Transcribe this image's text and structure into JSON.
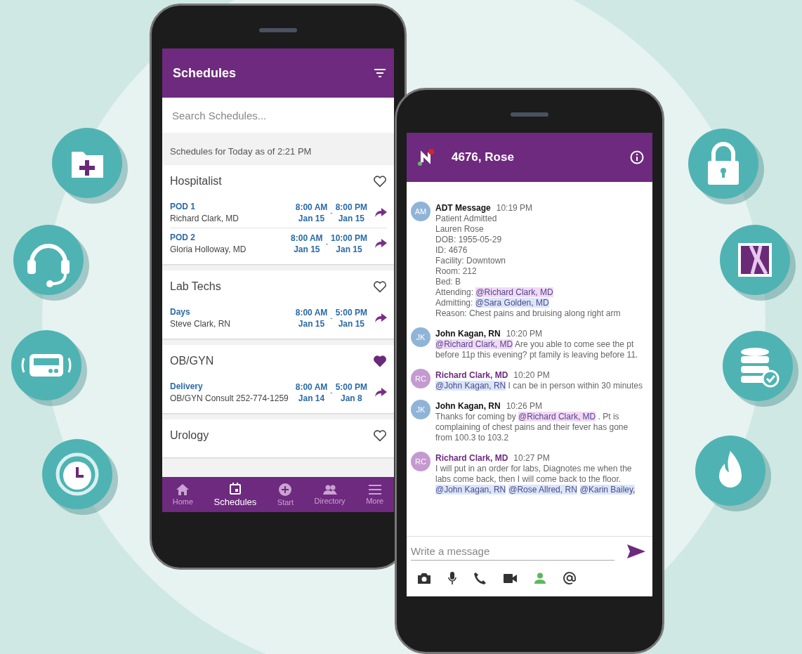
{
  "schedules_screen": {
    "title": "Schedules",
    "search": {
      "placeholder": "Search Schedules..."
    },
    "subtitle": "Schedules for Today as of 2:21 PM",
    "groups": [
      {
        "title": "Hospitalist",
        "favorite": false,
        "shifts": [
          {
            "name": "POD 1",
            "person": "Richard Clark, MD",
            "start_time": "8:00 AM",
            "start_date": "Jan 15",
            "separator": "-",
            "end_time": "8:00 PM",
            "end_date": "Jan 15"
          },
          {
            "name": "POD 2",
            "person": "Gloria Holloway, MD",
            "start_time": "8:00 AM",
            "start_date": "Jan 15",
            "separator": "-",
            "end_time": "10:00 PM",
            "end_date": "Jan 15"
          }
        ]
      },
      {
        "title": "Lab Techs",
        "favorite": false,
        "shifts": [
          {
            "name": "Days",
            "person": "Steve Clark, RN",
            "start_time": "8:00 AM",
            "start_date": "Jan 15",
            "separator": "-",
            "end_time": "5:00 PM",
            "end_date": "Jan 15"
          }
        ]
      },
      {
        "title": "OB/GYN",
        "favorite": true,
        "shifts": [
          {
            "name": "Delivery",
            "person": "OB/GYN Consult 252-774-1259",
            "start_time": "8:00 AM",
            "start_date": "Jan 14",
            "separator": "-",
            "end_time": "5:00 PM",
            "end_date": "Jan 8"
          }
        ]
      },
      {
        "title": "Urology",
        "favorite": false
      }
    ],
    "nav": [
      {
        "label": "Home",
        "selected": false
      },
      {
        "label": "Schedules",
        "selected": true
      },
      {
        "label": "Start",
        "selected": false
      },
      {
        "label": "Directory",
        "selected": false
      },
      {
        "label": "More",
        "selected": false
      }
    ]
  },
  "chat_screen": {
    "title": "4676, Rose",
    "messages": [
      {
        "initials": "AM",
        "color": "#8fb4d8",
        "author": "ADT Message",
        "self": false,
        "time": "10:19 PM",
        "paragraphs": [
          [
            {
              "text": "Patient Admitted",
              "mention": false
            }
          ],
          [
            {
              "text": "Lauren Rose",
              "mention": false
            }
          ],
          [
            {
              "text": "DOB: 1955-05-29",
              "mention": false
            }
          ],
          [
            {
              "text": "ID: 4676",
              "mention": false
            }
          ],
          [
            {
              "text": "Facility: Downtown",
              "mention": false
            }
          ],
          [
            {
              "text": "Room: 212",
              "mention": false
            }
          ],
          [
            {
              "text": "Bed: B",
              "mention": false
            }
          ],
          [
            {
              "text": "Attending: ",
              "mention": false
            },
            {
              "text": "@Richard Clark, MD",
              "mention": true,
              "color": "#f4d8f4"
            }
          ],
          [
            {
              "text": "Admitting: ",
              "mention": false
            },
            {
              "text": "@Sara Golden, MD",
              "mention": true,
              "color": "#dbe6f8"
            }
          ],
          [
            {
              "text": "Reason: Chest pains and bruising along right arm",
              "mention": false
            }
          ]
        ]
      },
      {
        "initials": "JK",
        "color": "#8fb4d8",
        "author": "John Kagan, RN",
        "self": false,
        "time": "10:20 PM",
        "paragraphs": [
          [
            {
              "text": "@Richard Clark, MD",
              "mention": true,
              "color": "#f4d8f4"
            },
            {
              "text": " Are you able to come see the pt before 11p this evening? pt family is leaving before 11.",
              "mention": false
            }
          ]
        ]
      },
      {
        "initials": "RC",
        "color": "#c49ad0",
        "author": "Richard Clark, MD",
        "self": true,
        "time": "10:20 PM",
        "paragraphs": [
          [
            {
              "text": "@John Kagan, RN",
              "mention": true,
              "color": "#dbe6f8"
            },
            {
              "text": " I can be in person within 30 minutes",
              "mention": false
            }
          ]
        ]
      },
      {
        "initials": "JK",
        "color": "#8fb4d8",
        "author": "John Kagan, RN",
        "self": false,
        "time": "10:26 PM",
        "paragraphs": [
          [
            {
              "text": "Thanks for coming by ",
              "mention": false
            },
            {
              "text": "@Richard Clark, MD",
              "mention": true,
              "color": "#f4d8f4"
            },
            {
              "text": " . Pt is complaining of chest pains and their fever has gone from 100.3 to 103.2",
              "mention": false
            }
          ]
        ]
      },
      {
        "initials": "RC",
        "color": "#c49ad0",
        "author": "Richard Clark, MD",
        "self": true,
        "time": "10:27 PM",
        "paragraphs": [
          [
            {
              "text": "I will put in an order for labs, Diagnotes me when the labs come back, then I will come back to the floor. ",
              "mention": false
            },
            {
              "text": "@John Kagan, RN",
              "mention": true,
              "color": "#dbe6f8"
            },
            {
              "text": "@Rose Allred, RN",
              "mention": true,
              "color": "#dbe6f8"
            },
            {
              "text": "@Karin Bailey,",
              "mention": true,
              "color": "#dbe6f8"
            }
          ]
        ]
      }
    ],
    "composer": {
      "placeholder": "Write a message"
    }
  }
}
